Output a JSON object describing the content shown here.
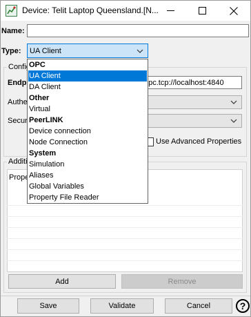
{
  "window": {
    "title": "Device: Telit Laptop Queensland.[N...",
    "minimize_glyph": "—",
    "maximize_glyph": "☐",
    "close_glyph": "✕"
  },
  "form": {
    "name_label": "Name:",
    "name_value": "",
    "type_label": "Type:",
    "type_value": "UA Client"
  },
  "config": {
    "group_title": "Configuration",
    "endpoint_label": "Endpoint",
    "endpoint_value": "opc.tcp://localhost:4840",
    "auth_label": "Authentication",
    "security_label": "Security",
    "use_advanced_label": "Use Advanced Properties"
  },
  "additional": {
    "group_title": "Additional Properties",
    "column_header": "Property",
    "add_label": "Add",
    "remove_label": "Remove"
  },
  "type_dropdown": {
    "items": [
      {
        "label": "OPC",
        "kind": "group"
      },
      {
        "label": "UA Client",
        "kind": "item",
        "selected": true
      },
      {
        "label": "DA Client",
        "kind": "item"
      },
      {
        "label": "Other",
        "kind": "group"
      },
      {
        "label": "Virtual",
        "kind": "item"
      },
      {
        "label": "PeerLINK",
        "kind": "group"
      },
      {
        "label": "Device connection",
        "kind": "item"
      },
      {
        "label": "Node Connection",
        "kind": "item"
      },
      {
        "label": "System",
        "kind": "group"
      },
      {
        "label": "Simulation",
        "kind": "item"
      },
      {
        "label": "Aliases",
        "kind": "item"
      },
      {
        "label": "Global Variables",
        "kind": "item"
      },
      {
        "label": "Property File Reader",
        "kind": "item"
      }
    ]
  },
  "footer": {
    "save_label": "Save",
    "validate_label": "Validate",
    "cancel_label": "Cancel",
    "help_glyph": "?"
  },
  "colors": {
    "accent": "#0078d7",
    "selection_fill": "#cce4f7"
  }
}
